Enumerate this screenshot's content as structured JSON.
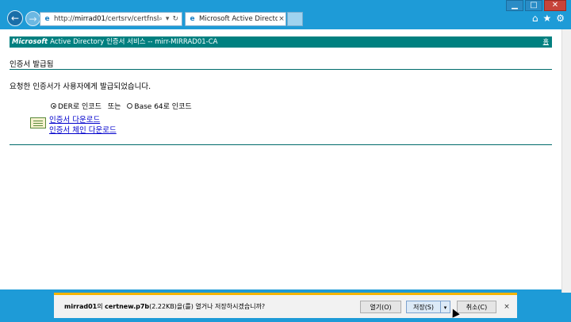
{
  "toolbar": {
    "back_icon": "back-arrow-icon",
    "forward_icon": "forward-arrow-icon",
    "address_prefix": "http://",
    "address_host": "mirrad01",
    "address_path": "/certsrv/certfnsh.asp",
    "search_icon": "search-icon",
    "refresh_icon": "refresh-icon"
  },
  "tab": {
    "title": "Microsoft Active Directory ...",
    "close": "×"
  },
  "window": {
    "minimize": "▁",
    "maximize": "□",
    "close": "✕"
  },
  "page": {
    "header_brand": "Microsoft",
    "header_rest": "Active Directory 인증서 서비스  --  mirr-MIRRAD01-CA",
    "header_home": "홈",
    "heading": "인증서 발급됨",
    "message": "요청한 인증서가 사용자에게 발급되었습니다.",
    "radio_der": "DER로 인코드",
    "radio_or": "또는",
    "radio_base64": "Base 64로 인코드",
    "link_cert": "인증서 다운로드",
    "link_chain": "인증서 체인 다운로드"
  },
  "download_bar": {
    "host": "mirrad01",
    "text_mid": "의 ",
    "file": "certnew.p7b",
    "text_tail": "(2.22KB)을(를) 열거나 저장하시겠습니까?",
    "open_label": "열기(O)",
    "save_label": "저장(S)",
    "dropdown": "▾",
    "cancel_label": "취소(C)",
    "close": "×"
  },
  "colors": {
    "frame": "#1e9bd7",
    "header": "#008080",
    "link": "#0000cc",
    "notify_accent": "#f5b400"
  }
}
